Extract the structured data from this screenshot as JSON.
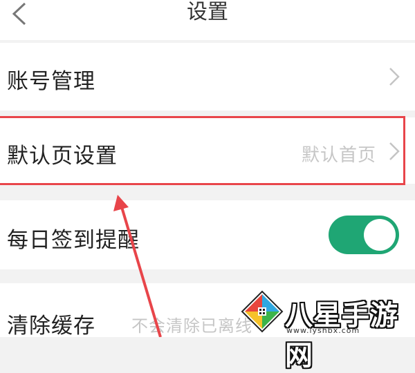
{
  "header": {
    "title": "设置"
  },
  "settings": {
    "account": {
      "label": "账号管理"
    },
    "default_page": {
      "label": "默认页设置",
      "value": "默认首页"
    },
    "daily_checkin": {
      "label": "每日签到提醒",
      "toggle_on": true
    },
    "clear_cache": {
      "label": "清除缓存",
      "value": "不会清除已离线"
    }
  },
  "watermark": {
    "name": "八星手游网",
    "url": "www.lyshbx.com"
  },
  "colors": {
    "toggle_on": "#1fa674",
    "highlight": "#e8454a"
  },
  "icons": {
    "back": "chevron-left-icon",
    "row_arrow": "chevron-right-icon"
  }
}
